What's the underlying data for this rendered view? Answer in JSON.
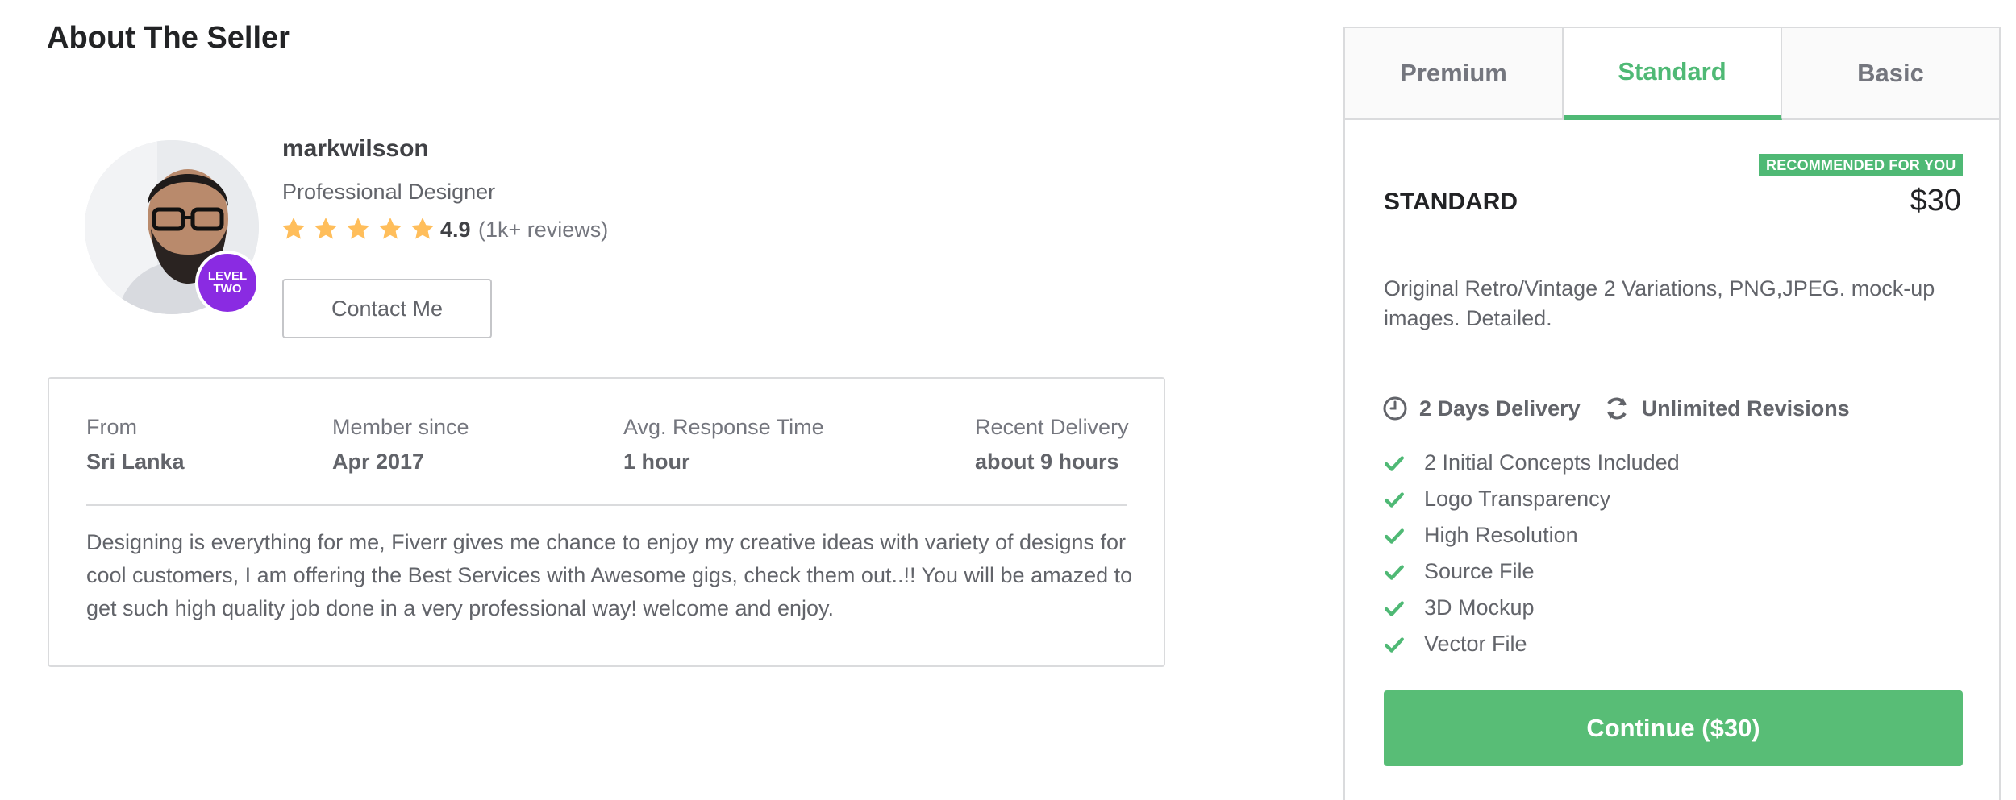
{
  "about": {
    "title": "About The Seller",
    "seller": {
      "username": "markwilsson",
      "profession": "Professional Designer",
      "rating": "4.9",
      "reviews": "(1k+ reviews)",
      "stars": 5,
      "level_badge_line1": "LEVEL",
      "level_badge_line2": "TWO",
      "contact_label": "Contact Me"
    },
    "stats": [
      {
        "label": "From",
        "value": "Sri Lanka"
      },
      {
        "label": "Member since",
        "value": "Apr 2017"
      },
      {
        "label": "Avg. Response Time",
        "value": "1 hour"
      },
      {
        "label": "Recent Delivery",
        "value": "about 9 hours"
      }
    ],
    "bio": "Designing is everything for me, Fiverr gives me chance to enjoy my creative ideas with variety of designs for cool customers, I am offering the Best Services with Awesome gigs, check them out..!! You will be amazed to get such high quality job done in a very professional way! welcome and enjoy."
  },
  "package": {
    "tabs": [
      {
        "label": "Premium",
        "active": false
      },
      {
        "label": "Standard",
        "active": true
      },
      {
        "label": "Basic",
        "active": false
      }
    ],
    "recommended_label": "RECOMMENDED FOR YOU",
    "name": "STANDARD",
    "price": "$30",
    "description": "Original Retro/Vintage 2 Variations, PNG,JPEG. mock-up images. Detailed.",
    "delivery": "2 Days Delivery",
    "revisions": "Unlimited Revisions",
    "features": [
      "2 Initial Concepts Included",
      "Logo Transparency",
      "High Resolution",
      "Source File",
      "3D Mockup",
      "Vector File"
    ],
    "continue_label": "Continue ($30)"
  },
  "colors": {
    "accent_green": "#4fb975",
    "star_yellow": "#ffbe5b",
    "level_purple": "#8a2be2"
  }
}
